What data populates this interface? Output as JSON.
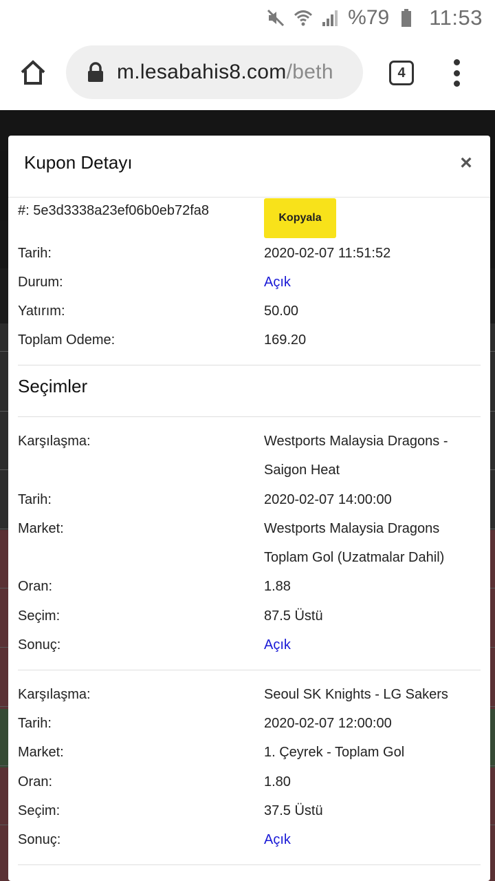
{
  "status_bar": {
    "battery_text": "%79",
    "time": "11:53"
  },
  "browser": {
    "url_main": "m.lesabahis8.com",
    "url_path": "/beth",
    "tab_count": "4"
  },
  "modal": {
    "title": "Kupon Detayı",
    "close_label": "×",
    "copy_label": "Kopyala",
    "coupon": {
      "id_label": "#: 5e3d3338a23ef06b0eb72fa8",
      "date_label": "Tarih:",
      "date_value": "2020-02-07 11:51:52",
      "status_label": "Durum:",
      "status_value": "Açık",
      "stake_label": "Yatırım:",
      "stake_value": "50.00",
      "payout_label": "Toplam Odeme:",
      "payout_value": "169.20"
    },
    "selections_title": "Seçimler",
    "selections": [
      {
        "match_label": "Karşılaşma:",
        "match_value": "Westports Malaysia Dragons - Saigon Heat",
        "date_label": "Tarih:",
        "date_value": "2020-02-07 14:00:00",
        "market_label": "Market:",
        "market_value": "Westports Malaysia Dragons Toplam Gol (Uzatmalar Dahil)",
        "odds_label": "Oran:",
        "odds_value": "1.88",
        "pick_label": "Seçim:",
        "pick_value": "87.5 Üstü",
        "result_label": "Sonuç:",
        "result_value": "Açık"
      },
      {
        "match_label": "Karşılaşma:",
        "match_value": "Seoul SK Knights - LG Sakers",
        "date_label": "Tarih:",
        "date_value": "2020-02-07 12:00:00",
        "market_label": "Market:",
        "market_value": "1. Çeyrek - Toplam Gol",
        "odds_label": "Oran:",
        "odds_value": "1.80",
        "pick_label": "Seçim:",
        "pick_value": "37.5 Üstü",
        "result_label": "Sonuç:",
        "result_value": "Açık"
      }
    ]
  },
  "colors": {
    "copy_button": "#f8e21a",
    "status_open": "#1a1ad6",
    "bg_red_rows": "#7a4548",
    "bg_green_row": "#4f6b4c"
  }
}
